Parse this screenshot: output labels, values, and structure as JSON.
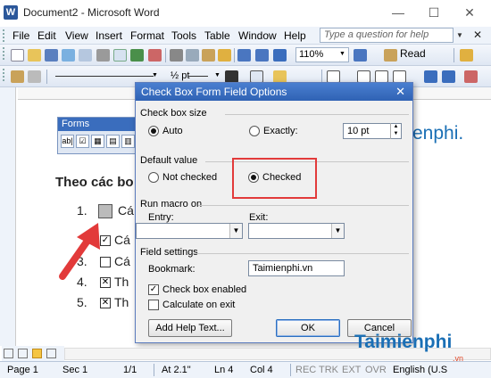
{
  "window": {
    "icon_letter": "W",
    "title": "Document2 - Microsoft Word",
    "minimize": "—",
    "maximize": "☐",
    "close": "✕"
  },
  "menu": {
    "items": [
      {
        "label": "File"
      },
      {
        "label": "Edit"
      },
      {
        "label": "View"
      },
      {
        "label": "Insert"
      },
      {
        "label": "Format"
      },
      {
        "label": "Tools"
      },
      {
        "label": "Table"
      },
      {
        "label": "Window"
      },
      {
        "label": "Help"
      }
    ],
    "help_placeholder": "Type a question for help",
    "close": "✕"
  },
  "toolbar": {
    "zoom": "110%",
    "read_label": "Read",
    "line_weight": "½ pt"
  },
  "forms_toolbar": {
    "title": "Forms",
    "buttons": [
      "ab|",
      "☑",
      "▦",
      "▤",
      "▥"
    ]
  },
  "document": {
    "heading": "Theo các bo",
    "items": [
      {
        "num": "1.",
        "text": "Cá"
      },
      {
        "num": "",
        "text": "Cá"
      },
      {
        "num": "3.",
        "text": "Cá"
      },
      {
        "num": "4.",
        "text": "Th"
      },
      {
        "num": "5.",
        "text": "Th"
      }
    ],
    "side_text": "enphi."
  },
  "dialog": {
    "title": "Check Box Form Field Options",
    "close": "✕",
    "size_section": "Check box size",
    "auto_label": "Auto",
    "exactly_label": "Exactly:",
    "exactly_value": "10 pt",
    "default_section": "Default value",
    "not_checked_label": "Not checked",
    "checked_label": "Checked",
    "macro_section": "Run macro on",
    "entry_label": "Entry:",
    "exit_label": "Exit:",
    "field_section": "Field settings",
    "bookmark_label": "Bookmark:",
    "bookmark_value": "Taimienphi.vn",
    "enabled_label": "Check box enabled",
    "calc_label": "Calculate on exit",
    "help_button": "Add Help Text...",
    "ok_button": "OK",
    "cancel_button": "Cancel"
  },
  "status": {
    "page": "Page 1",
    "sec": "Sec 1",
    "pages": "1/1",
    "at": "At 2.1\"",
    "ln": "Ln 4",
    "col": "Col 4",
    "rec": "REC",
    "trk": "TRK",
    "ext": "EXT",
    "ovr": "OVR",
    "lang": "English (U.S"
  },
  "watermark": {
    "brand": "Taimienphi",
    "suffix": ".vn"
  },
  "colors": {
    "accent": "#2f62b4",
    "highlight": "#e23a3a",
    "brand": "#1a6fb5"
  }
}
